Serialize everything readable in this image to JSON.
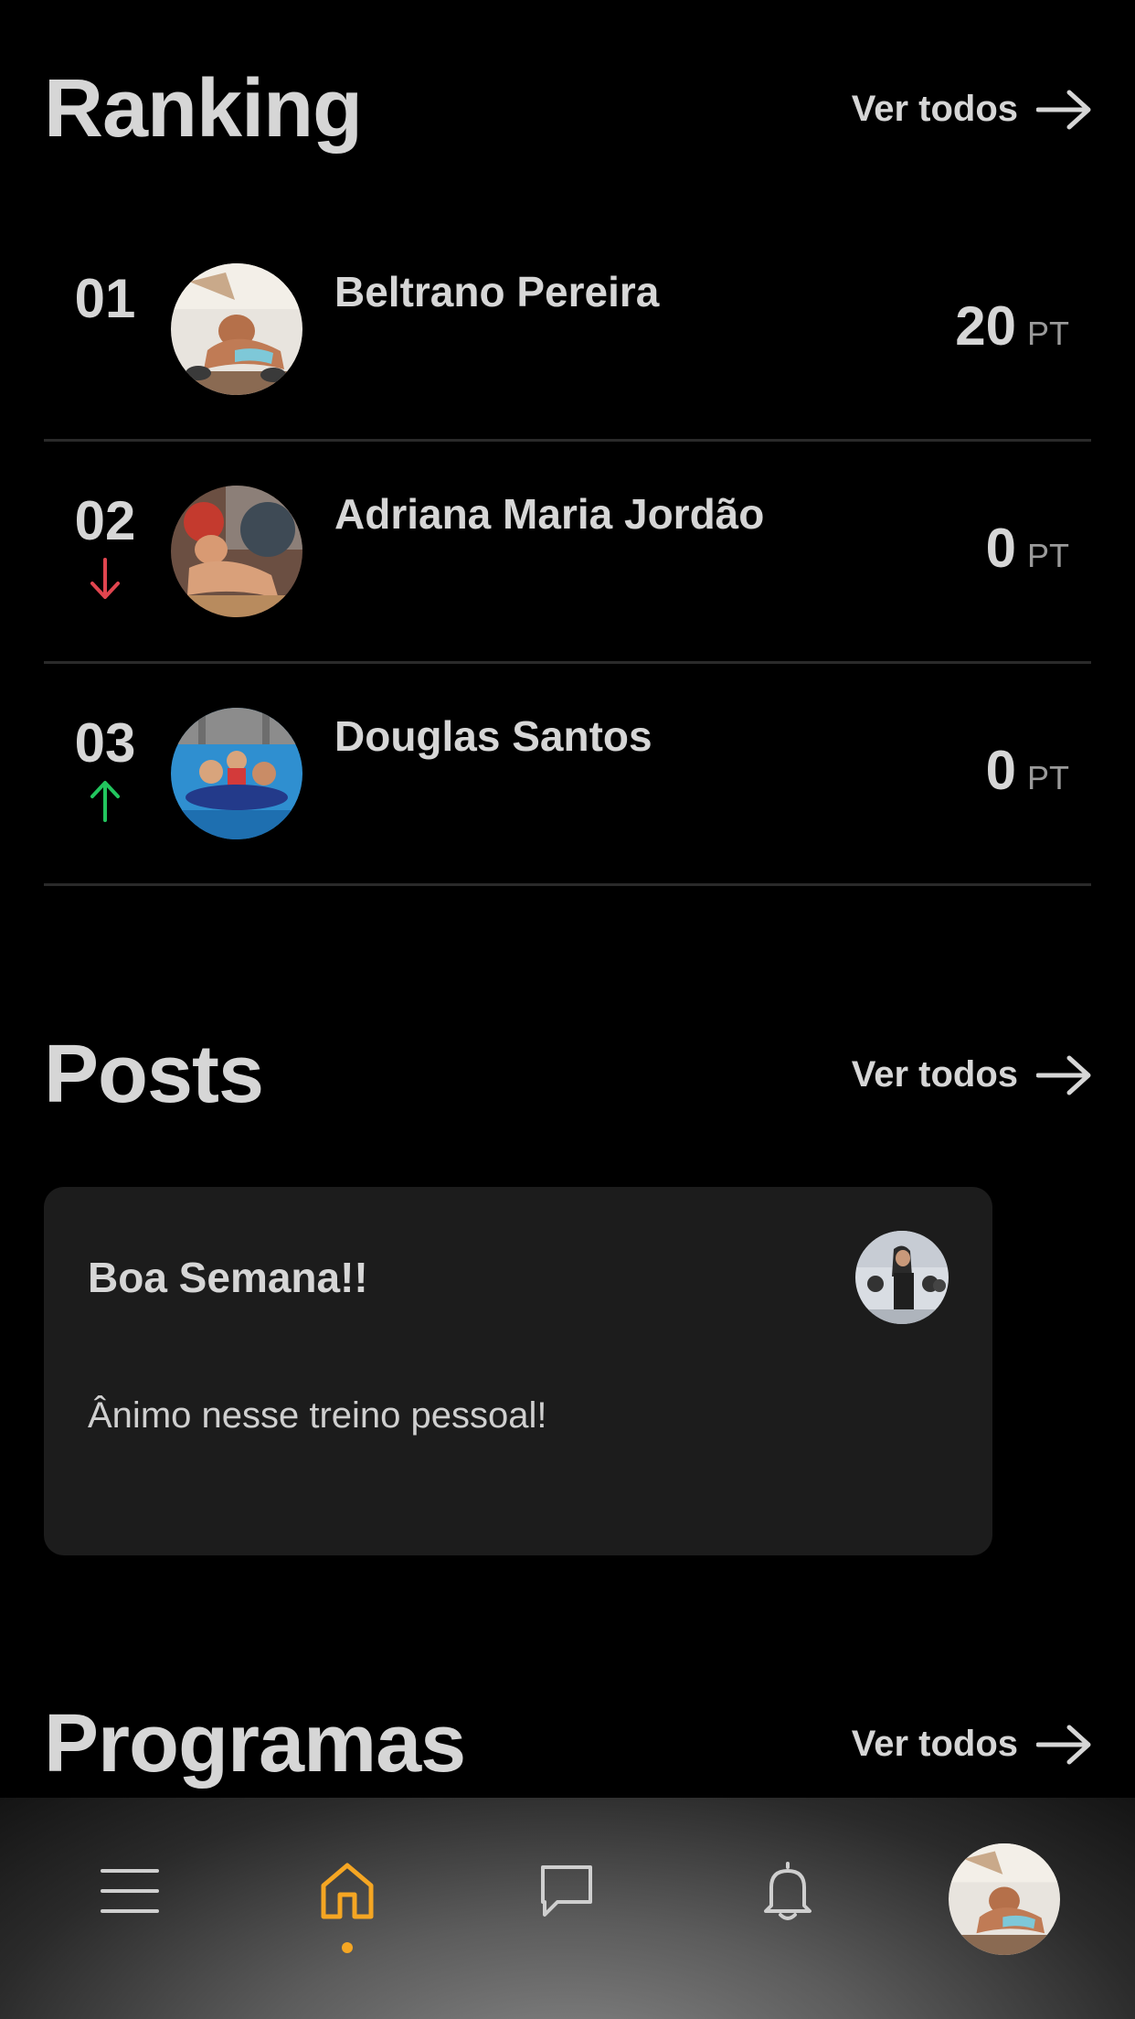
{
  "ranking": {
    "title": "Ranking",
    "see_all": "Ver todos",
    "rows": [
      {
        "position": "01",
        "name": "Beltrano Pereira",
        "points": "20",
        "unit": "PT",
        "trend": "none"
      },
      {
        "position": "02",
        "name": "Adriana Maria Jordão",
        "points": "0",
        "unit": "PT",
        "trend": "down"
      },
      {
        "position": "03",
        "name": "Douglas Santos",
        "points": "0",
        "unit": "PT",
        "trend": "up"
      }
    ]
  },
  "posts": {
    "title": "Posts",
    "see_all": "Ver todos",
    "card": {
      "title": "Boa Semana!!",
      "body": "Ânimo nesse treino pessoal!"
    }
  },
  "programs": {
    "title": "Programas",
    "see_all": "Ver todos"
  },
  "nav": {
    "items": [
      "menu-icon",
      "home-icon",
      "chat-icon",
      "bell-icon",
      "profile-avatar"
    ],
    "active": "home-icon"
  },
  "colors": {
    "background": "#000000",
    "accent": "#f5a623",
    "trend_down": "#e0454f",
    "trend_up": "#22c55e",
    "card": "#1c1c1c",
    "divider": "#2a2a2a"
  }
}
